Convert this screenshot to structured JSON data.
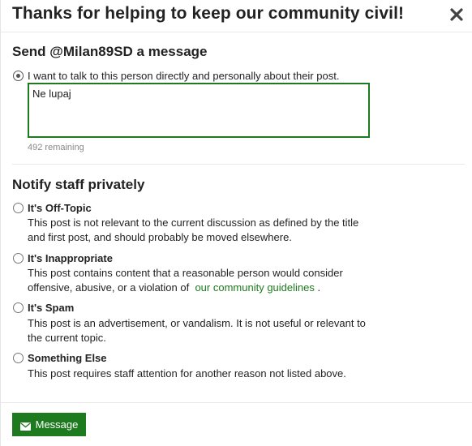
{
  "modal": {
    "title": "Thanks for helping to keep our community civil!",
    "close_icon": "close-icon"
  },
  "message_section": {
    "heading": "Send @Milan89SD a message",
    "option_label": "I want to talk to this person directly and personally about their post.",
    "option_selected": true,
    "textarea_value": "Ne lupaj",
    "remaining": "492 remaining"
  },
  "staff_section": {
    "heading": "Notify staff privately",
    "options": [
      {
        "title": "It's Off-Topic",
        "description": "This post is not relevant to the current discussion as defined by the title and first post, and should probably be moved elsewhere."
      },
      {
        "title": "It's Inappropriate",
        "description_before": "This post contains content that a reasonable person would consider offensive, abusive, or a violation of",
        "link_text": "our community guidelines",
        "description_after": "."
      },
      {
        "title": "It's Spam",
        "description": "This post is an advertisement, or vandalism. It is not useful or relevant to the current topic."
      },
      {
        "title": "Something Else",
        "description": "This post requires staff attention for another reason not listed above."
      }
    ]
  },
  "footer": {
    "send_label": "Message",
    "send_icon": "envelope-icon"
  },
  "colors": {
    "accent": "#1e7a1e",
    "muted_text": "#888888"
  }
}
